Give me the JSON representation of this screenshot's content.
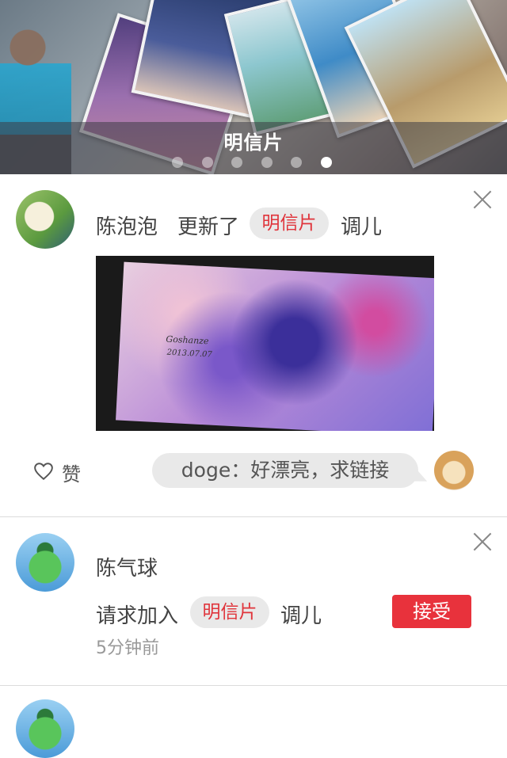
{
  "banner": {
    "caption": "明信片",
    "dots_total": 6,
    "active_dot_index": 5
  },
  "feed": [
    {
      "user_name": "陈泡泡",
      "action": "更新了",
      "tag": "明信片",
      "group_suffix": "调儿",
      "photo_text": [
        "Goshanze",
        "2013.07.07"
      ],
      "like_label": "赞",
      "comment": "doge：好漂亮，求链接"
    },
    {
      "user_name": "陈气球",
      "action": "请求加入",
      "tag": "明信片",
      "group_suffix": "调儿",
      "accept_label": "接受",
      "time": "5分钟前"
    }
  ],
  "colors": {
    "accent_red": "#e8323c",
    "tag_text": "#e0343b",
    "tag_bg": "#e9e9e9"
  },
  "icons": [
    "close-icon",
    "heart-icon"
  ]
}
